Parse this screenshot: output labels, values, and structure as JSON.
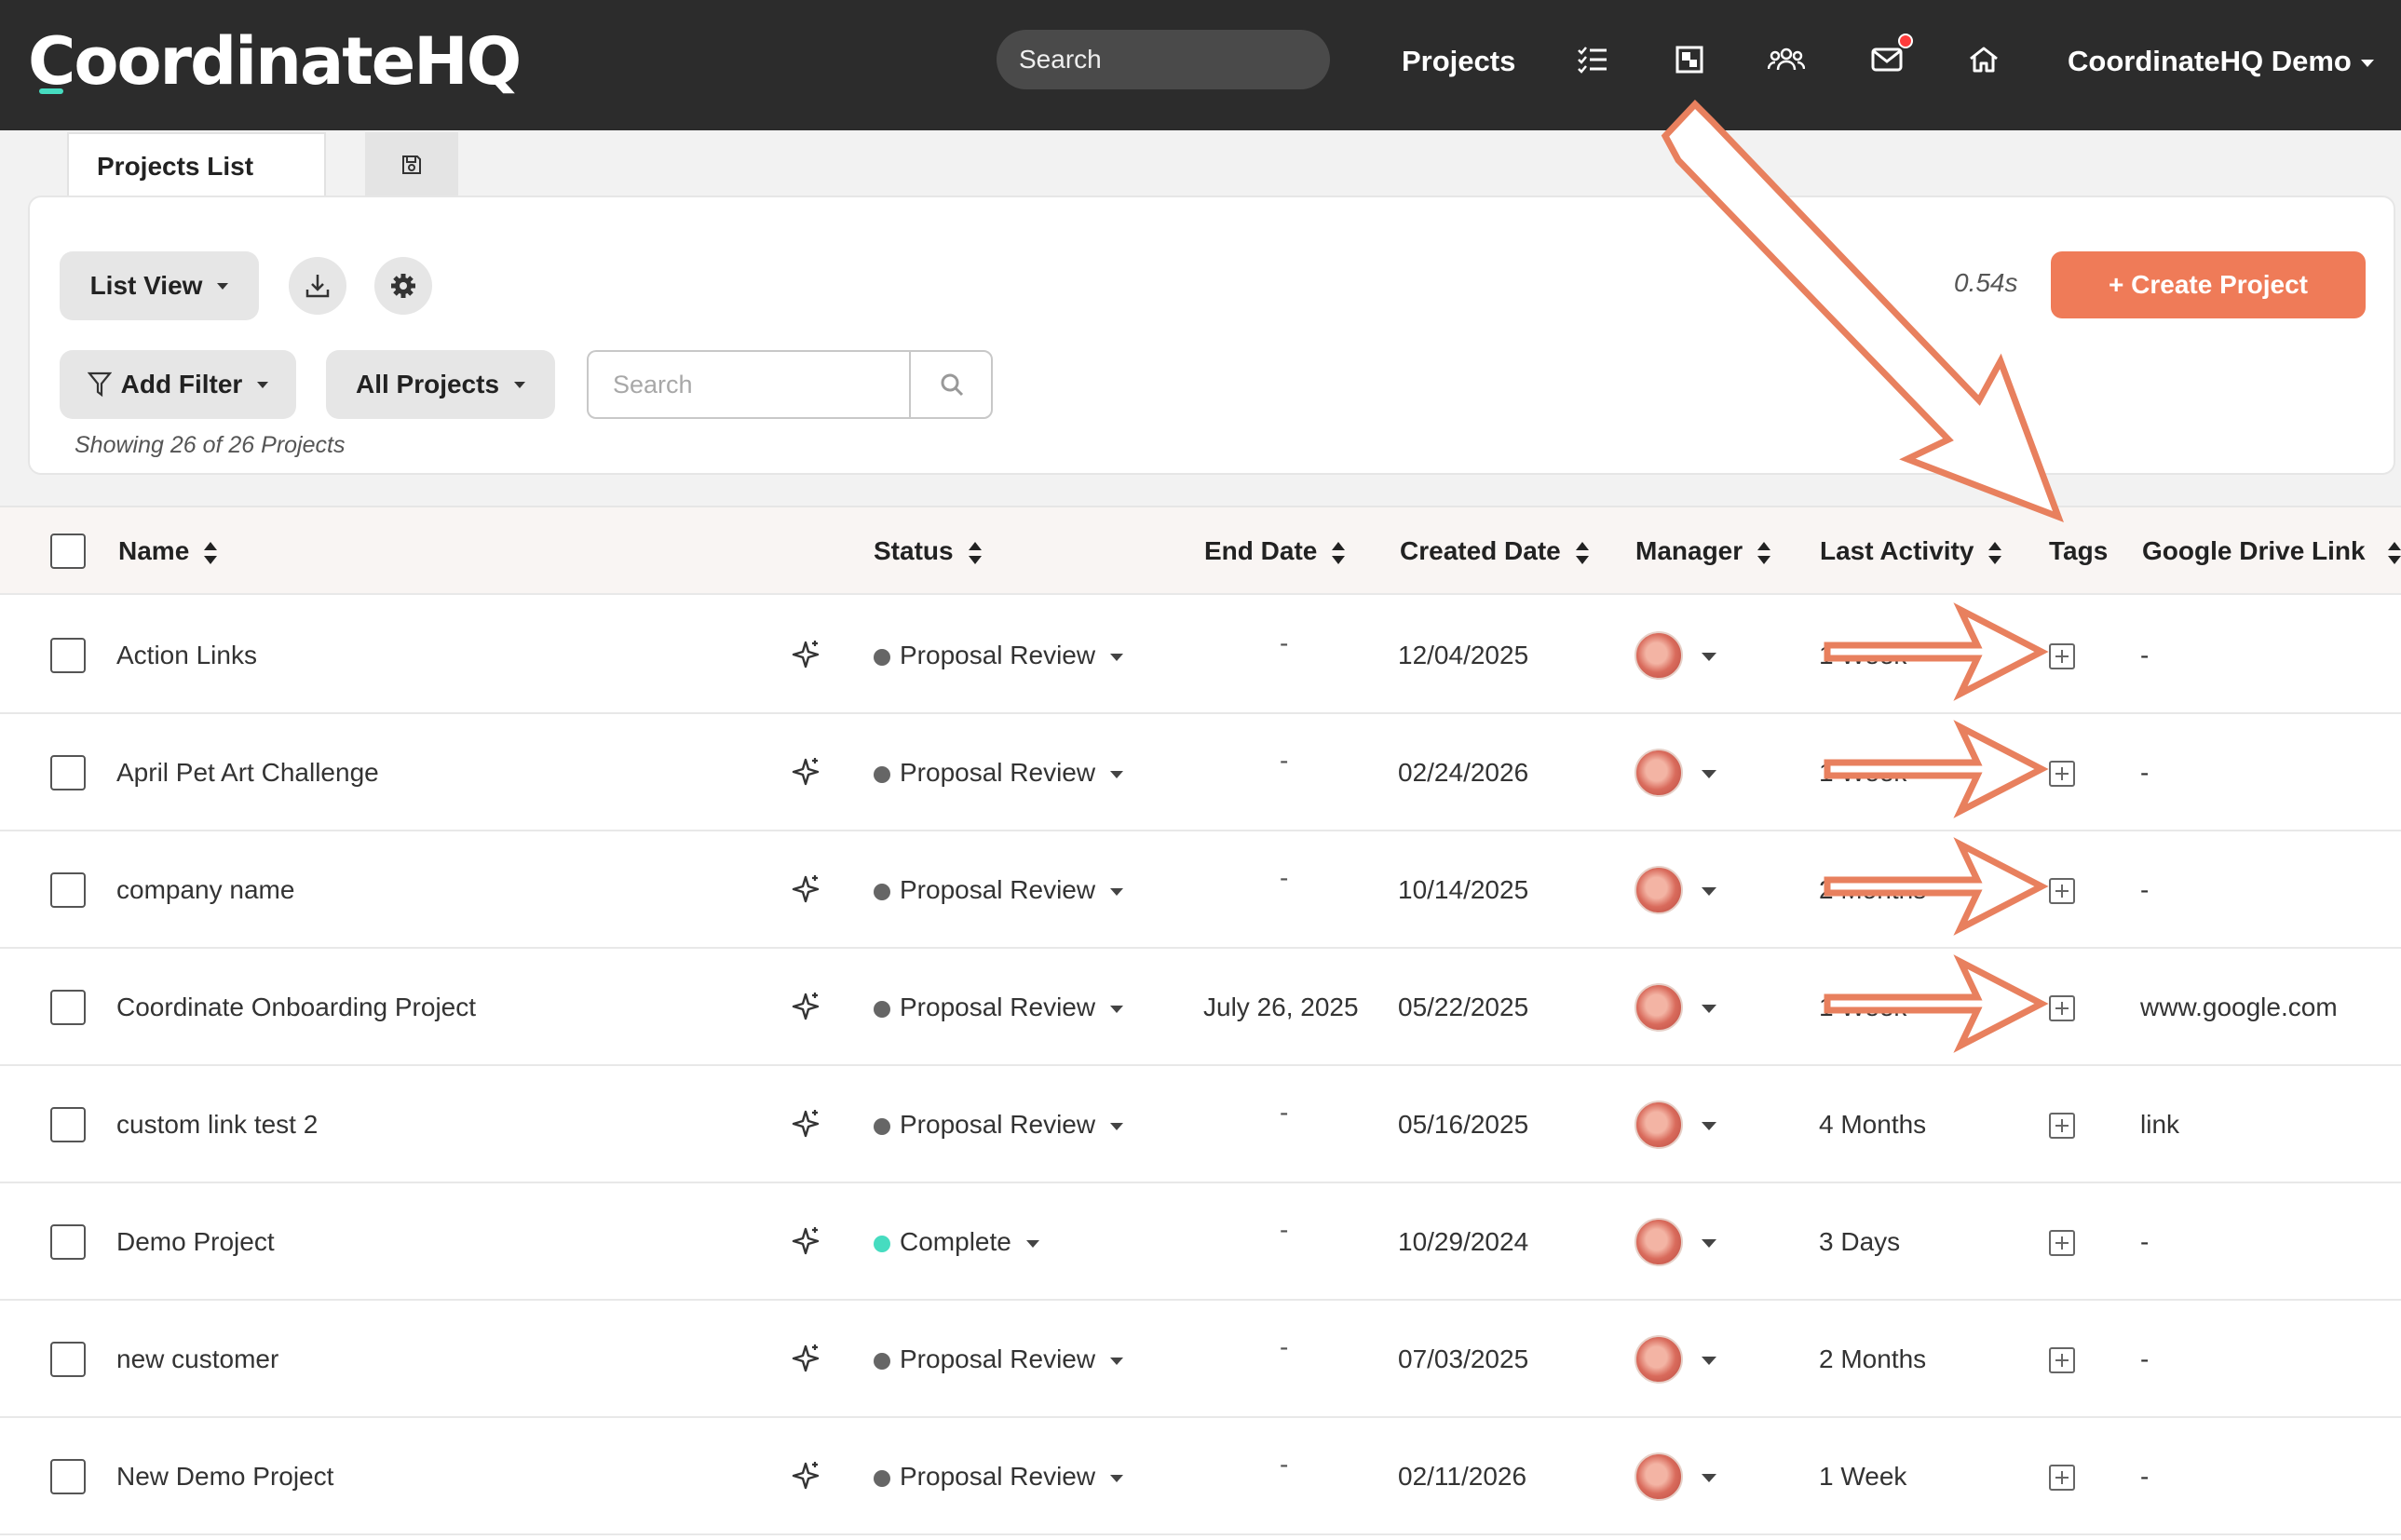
{
  "app": {
    "logo": "CoordinateHQ"
  },
  "topnav": {
    "search_label": "Search",
    "projects_label": "Projects",
    "user_label": "CoordinateHQ Demo",
    "icons": [
      "task-list-icon",
      "board-icon",
      "people-icon",
      "mail-icon",
      "home-icon"
    ],
    "notification_color": "#ff3b3b"
  },
  "tabs": {
    "active_label": "Projects List",
    "second_icon": "save-icon"
  },
  "toolbar": {
    "list_view_label": "List View",
    "add_filter_label": "Add Filter",
    "all_projects_label": "All Projects",
    "search_placeholder": "Search",
    "timing": "0.54s",
    "create_label": "+ Create Project",
    "showing_text": "Showing 26 of 26 Projects",
    "accent_color": "#ef7b58"
  },
  "table": {
    "headers": {
      "name": "Name",
      "status": "Status",
      "end_date": "End Date",
      "created_date": "Created Date",
      "manager": "Manager",
      "last_activity": "Last Activity",
      "tags": "Tags",
      "drive_link": "Google Drive Link"
    },
    "rows": [
      {
        "name": "Action Links",
        "status": "Proposal Review",
        "status_color": "#666666",
        "end_date": "-",
        "created_date": "12/04/2025",
        "last_activity": "1 Week",
        "drive_link": "-"
      },
      {
        "name": "April Pet Art Challenge",
        "status": "Proposal Review",
        "status_color": "#666666",
        "end_date": "-",
        "created_date": "02/24/2026",
        "last_activity": "1 Week",
        "drive_link": "-"
      },
      {
        "name": "company name",
        "status": "Proposal Review",
        "status_color": "#666666",
        "end_date": "-",
        "created_date": "10/14/2025",
        "last_activity": "2 Months",
        "drive_link": "-"
      },
      {
        "name": "Coordinate Onboarding Project",
        "status": "Proposal Review",
        "status_color": "#666666",
        "end_date": "July 26, 2025",
        "created_date": "05/22/2025",
        "last_activity": "1 Week",
        "drive_link": "www.google.com"
      },
      {
        "name": "custom link test 2",
        "status": "Proposal Review",
        "status_color": "#666666",
        "end_date": "-",
        "created_date": "05/16/2025",
        "last_activity": "4 Months",
        "drive_link": "link"
      },
      {
        "name": "Demo Project",
        "status": "Complete",
        "status_color": "#46dcc0",
        "end_date": "-",
        "created_date": "10/29/2024",
        "last_activity": "3 Days",
        "drive_link": "-"
      },
      {
        "name": "new customer",
        "status": "Proposal Review",
        "status_color": "#666666",
        "end_date": "-",
        "created_date": "07/03/2025",
        "last_activity": "2 Months",
        "drive_link": "-"
      },
      {
        "name": "New Demo Project",
        "status": "Proposal Review",
        "status_color": "#666666",
        "end_date": "-",
        "created_date": "02/11/2026",
        "last_activity": "1 Week",
        "drive_link": "-"
      }
    ]
  },
  "annotation": {
    "arrow_color": "#e8805e"
  }
}
